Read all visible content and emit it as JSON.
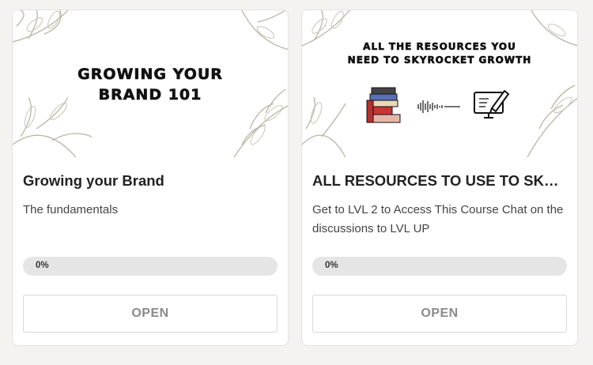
{
  "courses": [
    {
      "banner_text": "GROWING YOUR BRAND 101",
      "title": "Growing your Brand",
      "description": "The fundamentals",
      "progress_label": "0%",
      "progress": 0,
      "open_label": "OPEN"
    },
    {
      "banner_text": "ALL THE RESOURCES YOU NEED TO SKYROCKET GROWTH",
      "title": "ALL RESOURCES TO USE TO SKYROCKET GROWTH",
      "description": "Get to LVL 2 to Access This Course Chat on the discussions to LVL UP",
      "progress_label": "0%",
      "progress": 0,
      "open_label": "OPEN",
      "banner_icons": [
        "books-icon",
        "sound-wave-icon",
        "computer-edit-icon"
      ]
    }
  ],
  "colors": {
    "page_bg": "#f5f3f0",
    "leaf": "#b8b6a4",
    "progress_track": "#e5e5e5",
    "button_text": "#8a8a8a"
  }
}
